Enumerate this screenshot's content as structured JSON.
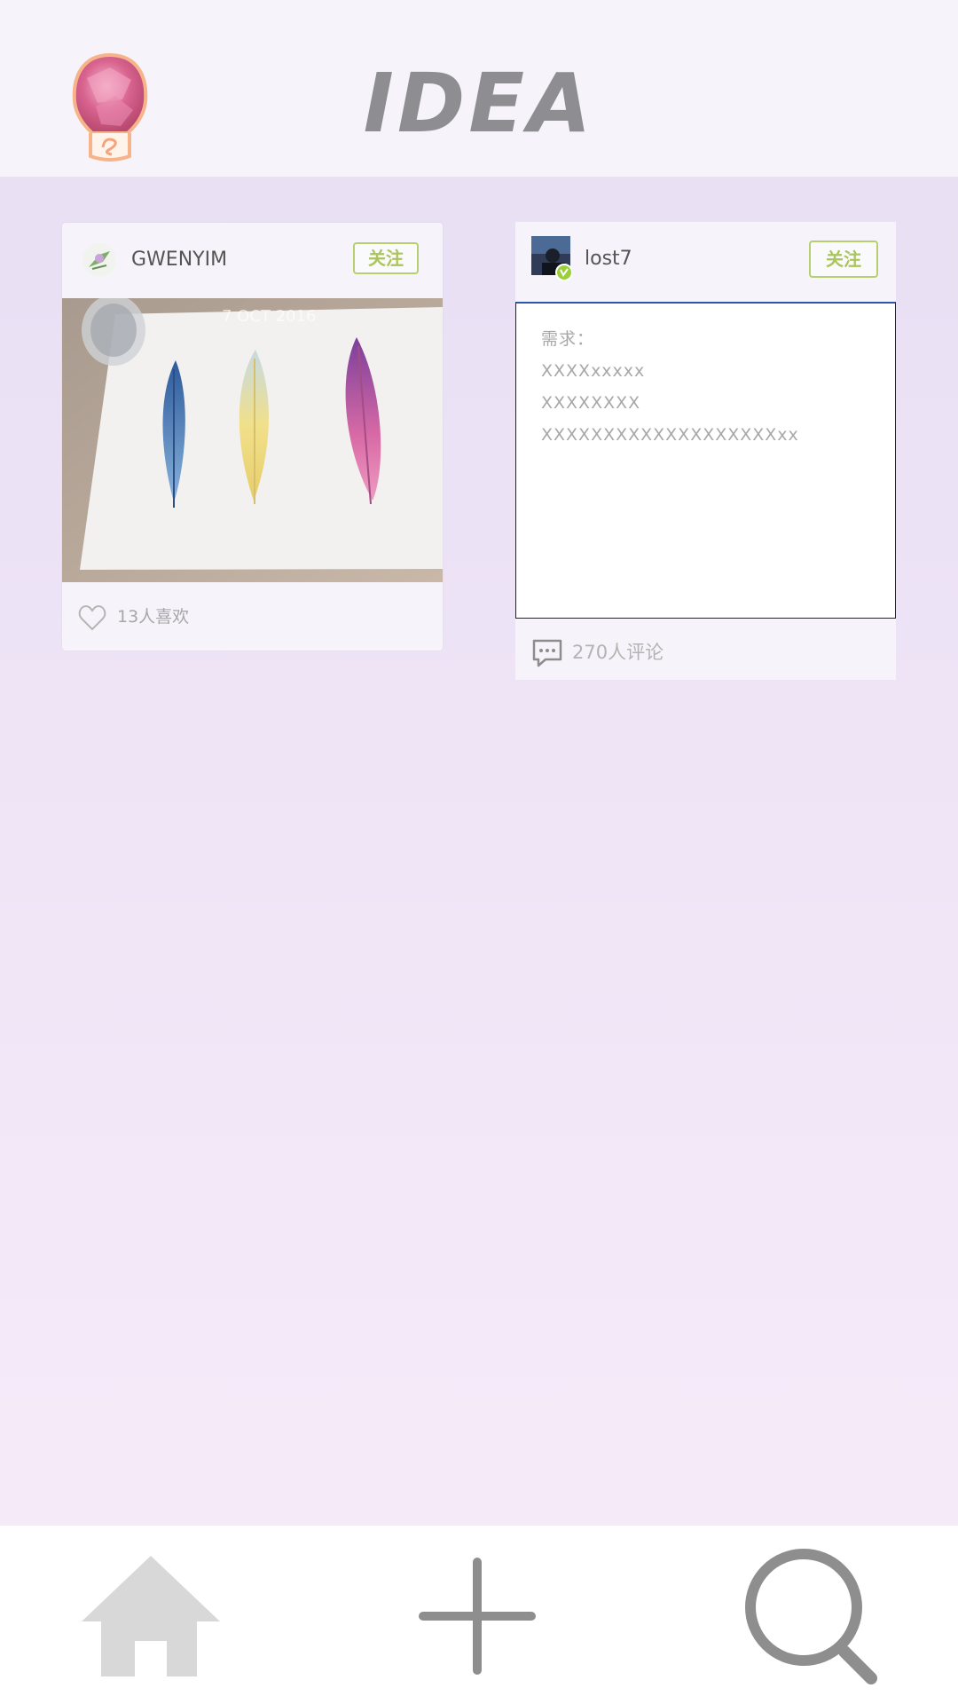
{
  "header": {
    "title": "IDEA"
  },
  "posts": [
    {
      "username": "GWENYIM",
      "follow_label": "关注",
      "photo_caption": "7 OCT 2016",
      "likes": "13人喜欢"
    },
    {
      "username": "lost7",
      "follow_label": "关注",
      "request_lines": [
        "需求：",
        "XXXXxxxxx",
        "XXXXXXXX",
        "XXXXXXXXXXXXXXXXXXXxx"
      ],
      "comments": "270人评论"
    }
  ],
  "nav": {
    "items": [
      "home-icon",
      "add-icon",
      "search-icon"
    ]
  },
  "colors": {
    "accent_green": "#a9c55b",
    "icon_gray": "#8e8e8e",
    "home_gray": "#d8d8d8"
  }
}
